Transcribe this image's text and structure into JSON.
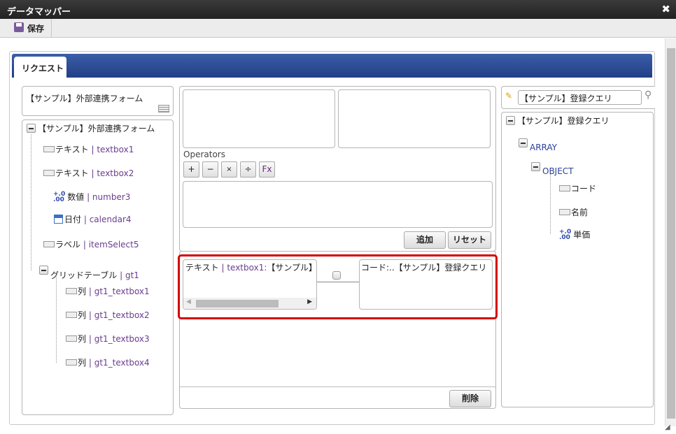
{
  "window": {
    "title": "データマッパー",
    "close": "✖"
  },
  "toolbar": {
    "save": "保存"
  },
  "tab": {
    "label": "リクエスト"
  },
  "left": {
    "form_name": "【サンプル】外部連携フォーム",
    "tree": {
      "root": "【サンプル】外部連携フォーム",
      "items": [
        {
          "name": "テキスト",
          "id": "| textbox1",
          "icon": "text"
        },
        {
          "name": "テキスト",
          "id": "| textbox2",
          "icon": "text"
        },
        {
          "name": "数値",
          "id": "| number3",
          "icon": "number"
        },
        {
          "name": "日付",
          "id": "| calendar4",
          "icon": "calendar"
        },
        {
          "name": "ラベル",
          "id": "| itemSelect5",
          "icon": "text"
        },
        {
          "name": "グリッドテーブル",
          "id": "| gt1",
          "icon": "minus"
        }
      ],
      "grid_children": [
        {
          "name": "列",
          "id": "| gt1_textbox1"
        },
        {
          "name": "列",
          "id": "| gt1_textbox2"
        },
        {
          "name": "列",
          "id": "| gt1_textbox3"
        },
        {
          "name": "列",
          "id": "| gt1_textbox4"
        }
      ]
    }
  },
  "middle": {
    "operators_label": "Operators",
    "operators": [
      "+",
      "−",
      "×",
      "÷",
      "Fx"
    ],
    "add": "追加",
    "reset": "リセット",
    "delete": "削除",
    "mapping": {
      "source_name": "テキスト",
      "source_id": "| textbox1:",
      "source_form": "【サンプル】外部連携",
      "target": "コード:..【サンプル】登録クエリ"
    }
  },
  "right": {
    "search_value": "【サンプル】登録クエリ",
    "tree": {
      "root": "【サンプル】登録クエリ",
      "array": "ARRAY",
      "object": "OBJECT",
      "items": [
        {
          "name": "コード",
          "icon": "text"
        },
        {
          "name": "名前",
          "icon": "text"
        },
        {
          "name": "単価",
          "icon": "number"
        }
      ]
    }
  },
  "colors": {
    "accent": "#2c4c98",
    "highlight": "#d40000"
  }
}
